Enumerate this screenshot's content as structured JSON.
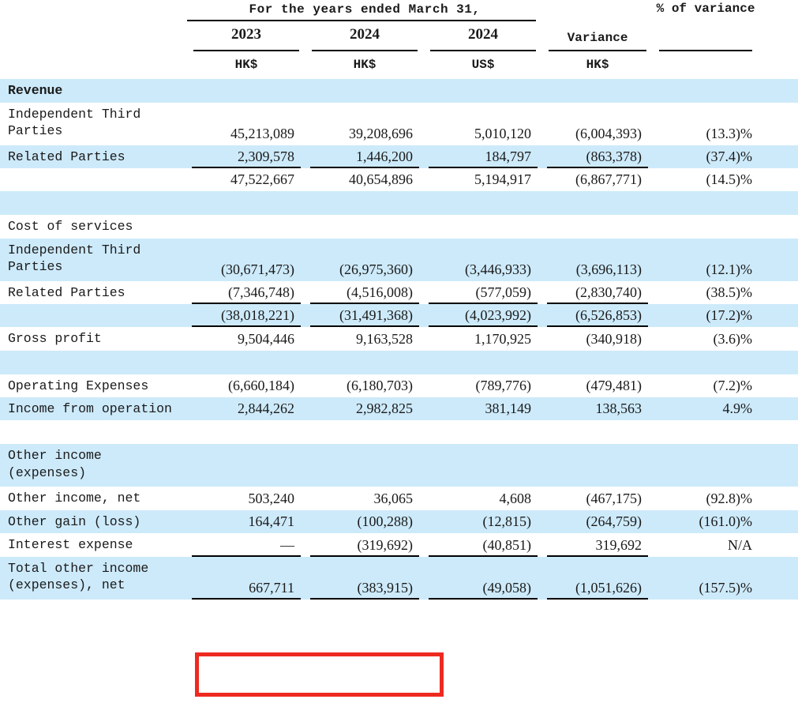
{
  "header": {
    "span_title": "For the  years ended March  31,",
    "columns": [
      {
        "name": "2023",
        "currency": "HK$"
      },
      {
        "name": "2024",
        "currency": "HK$"
      },
      {
        "name": "2024",
        "currency": "US$"
      },
      {
        "name": "Variance",
        "currency": "HK$"
      },
      {
        "name": "% of\nvariance",
        "currency": ""
      }
    ]
  },
  "colors": {
    "band": "#cdeafa",
    "highlight": "#ee2a20",
    "rule": "#000000"
  },
  "rows": [
    {
      "label": "Revenue",
      "style": "section-bold",
      "band": true,
      "values": [
        "",
        "",
        "",
        "",
        ""
      ]
    },
    {
      "label": "Independent Third\n  Parties",
      "style": "tall",
      "band": false,
      "values": [
        "45,213,089",
        "39,208,696",
        "5,010,120",
        "(6,004,393)",
        "(13.3)%"
      ]
    },
    {
      "label": "Related Parties",
      "style": "normal",
      "band": true,
      "rule_below": true,
      "values": [
        "2,309,578",
        "1,446,200",
        "184,797",
        "(863,378)",
        "(37.4)%"
      ]
    },
    {
      "label": "",
      "style": "normal",
      "band": false,
      "values": [
        "47,522,667",
        "40,654,896",
        "5,194,917",
        "(6,867,771)",
        "(14.5)%"
      ]
    },
    {
      "label": "",
      "style": "spacer",
      "band": true,
      "values": [
        "",
        "",
        "",
        "",
        ""
      ]
    },
    {
      "label": "Cost of services",
      "style": "normal",
      "band": false,
      "values": [
        "",
        "",
        "",
        "",
        ""
      ]
    },
    {
      "label": "Independent Third\n  Parties",
      "style": "tall",
      "band": true,
      "values": [
        "(30,671,473)",
        "(26,975,360)",
        "(3,446,933)",
        "(3,696,113)",
        "(12.1)%"
      ]
    },
    {
      "label": "Related Parties",
      "style": "normal",
      "band": false,
      "rule_below": true,
      "values": [
        "(7,346,748)",
        "(4,516,008)",
        "(577,059)",
        "(2,830,740)",
        "(38.5)%"
      ]
    },
    {
      "label": "",
      "style": "normal",
      "band": true,
      "rule_below": true,
      "values": [
        "(38,018,221)",
        "(31,491,368)",
        "(4,023,992)",
        "(6,526,853)",
        "(17.2)%"
      ]
    },
    {
      "label": "Gross profit",
      "style": "normal",
      "band": false,
      "values": [
        "9,504,446",
        "9,163,528",
        "1,170,925",
        "(340,918)",
        "(3.6)%"
      ]
    },
    {
      "label": "",
      "style": "spacer",
      "band": true,
      "values": [
        "",
        "",
        "",
        "",
        ""
      ]
    },
    {
      "label": "Operating Expenses",
      "style": "normal",
      "band": false,
      "values": [
        "(6,660,184)",
        "(6,180,703)",
        "(789,776)",
        "(479,481)",
        "(7.2)%"
      ]
    },
    {
      "label": "Income from operation",
      "style": "normal",
      "band": true,
      "values": [
        "2,844,262",
        "2,982,825",
        "381,149",
        "138,563",
        "4.9%"
      ]
    },
    {
      "label": "",
      "style": "gap",
      "band": false,
      "values": [
        "",
        "",
        "",
        "",
        ""
      ]
    },
    {
      "label": "Other income\n  (expenses)",
      "style": "tall",
      "band": true,
      "values": [
        "",
        "",
        "",
        "",
        ""
      ]
    },
    {
      "label": "Other income, net",
      "style": "normal",
      "band": false,
      "values": [
        "503,240",
        "36,065",
        "4,608",
        "(467,175)",
        "(92.8)%"
      ]
    },
    {
      "label": "Other gain (loss)",
      "style": "normal",
      "band": true,
      "values": [
        "164,471",
        "(100,288)",
        "(12,815)",
        "(264,759)",
        "(161.0)%"
      ]
    },
    {
      "label": "Interest expense",
      "style": "normal",
      "band": false,
      "rule_below": true,
      "values": [
        "—",
        "(319,692)",
        "(40,851)",
        "319,692",
        "N/A"
      ]
    },
    {
      "label": "Total other income\n  (expenses), net",
      "style": "tall",
      "band": true,
      "rule_below": true,
      "values": [
        "667,711",
        "(383,915)",
        "(49,058)",
        "(1,051,626)",
        "(157.5)%"
      ]
    }
  ],
  "highlight": {
    "note": "red rectangle around 2023 and 2024 HK$ figures of the total other income row",
    "cells": [
      "667,711",
      "(383,915)"
    ]
  }
}
